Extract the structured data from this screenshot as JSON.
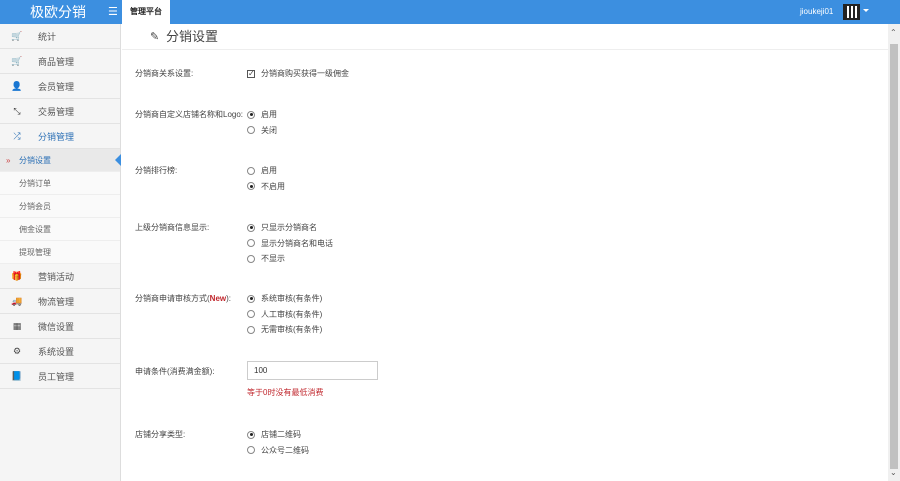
{
  "header": {
    "brand": "极欧分销",
    "active_tab": "管理平台",
    "username": "jioukeji01"
  },
  "sidebar": {
    "items_top": [
      {
        "icon": "cart-icon",
        "glyph": "🛒",
        "label": "统计"
      },
      {
        "icon": "cart-icon",
        "glyph": "🛒",
        "label": "商品管理"
      },
      {
        "icon": "user-icon",
        "glyph": "👤",
        "label": "会员管理"
      },
      {
        "icon": "compress-icon",
        "glyph": "⤡",
        "label": "交易管理"
      },
      {
        "icon": "shuffle-icon",
        "glyph": "⤮",
        "label": "分销管理"
      }
    ],
    "sub_items": [
      "分销设置",
      "分销订单",
      "分销会员",
      "佣金设置",
      "提现管理"
    ],
    "items_bottom": [
      {
        "icon": "gift-icon",
        "glyph": "🎁",
        "label": "营销活动"
      },
      {
        "icon": "truck-icon",
        "glyph": "🚚",
        "label": "物流管理"
      },
      {
        "icon": "qrcode-icon",
        "glyph": "▦",
        "label": "微信设置"
      },
      {
        "icon": "gear-icon",
        "glyph": "⚙",
        "label": "系统设置"
      },
      {
        "icon": "book-icon",
        "glyph": "📘",
        "label": "员工管理"
      }
    ]
  },
  "page": {
    "title": "分销设置"
  },
  "form": {
    "relation_label": "分销商关系设置:",
    "relation_checkbox": "分销商购买获得一级佣金",
    "custom_label": "分销商自定义店铺名称和Logo:",
    "custom_options": [
      "启用",
      "关闭"
    ],
    "rank_label": "分销排行榜:",
    "rank_options": [
      "启用",
      "不启用"
    ],
    "parent_label": "上级分销商信息显示:",
    "parent_options": [
      "只显示分销商名",
      "显示分销商名和电话",
      "不显示"
    ],
    "audit_label_pre": "分销商申请审核方式(",
    "audit_label_new": "New",
    "audit_label_post": "):",
    "audit_options": [
      "系统审核(有条件)",
      "人工审核(有条件)",
      "无需审核(有条件)"
    ],
    "condition_label": "申请条件(消费满金额):",
    "condition_value": "100",
    "condition_hint": "等于0时没有最低消费",
    "share_label": "店铺分享类型:",
    "share_options": [
      "店铺二维码",
      "公众号二维码"
    ]
  }
}
